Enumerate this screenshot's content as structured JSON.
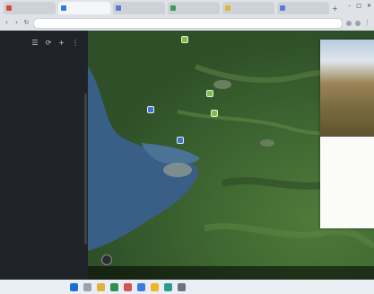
{
  "browser": {
    "tabs": [
      {
        "label": "",
        "active": false
      },
      {
        "label": "",
        "active": true
      },
      {
        "label": "",
        "active": false
      },
      {
        "label": "",
        "active": false
      },
      {
        "label": "",
        "active": false
      },
      {
        "label": "",
        "active": false
      }
    ],
    "address": ""
  },
  "sidebar": {
    "items": [
      "",
      "",
      "",
      "",
      "",
      "",
      "",
      "",
      "",
      "",
      "",
      "",
      "",
      ""
    ]
  },
  "map": {
    "place_labels": [
      "",
      ""
    ]
  },
  "panel": {
    "title": "",
    "text": ""
  },
  "map_bottom": {
    "left_text": "",
    "right_text": ""
  },
  "taskbar": {
    "weather": "",
    "time": ""
  },
  "colors": {
    "sea": "#3a5f86",
    "land": "#3e6631",
    "pin_green": "#7cc04a",
    "pin_blue": "#3b73d6"
  }
}
